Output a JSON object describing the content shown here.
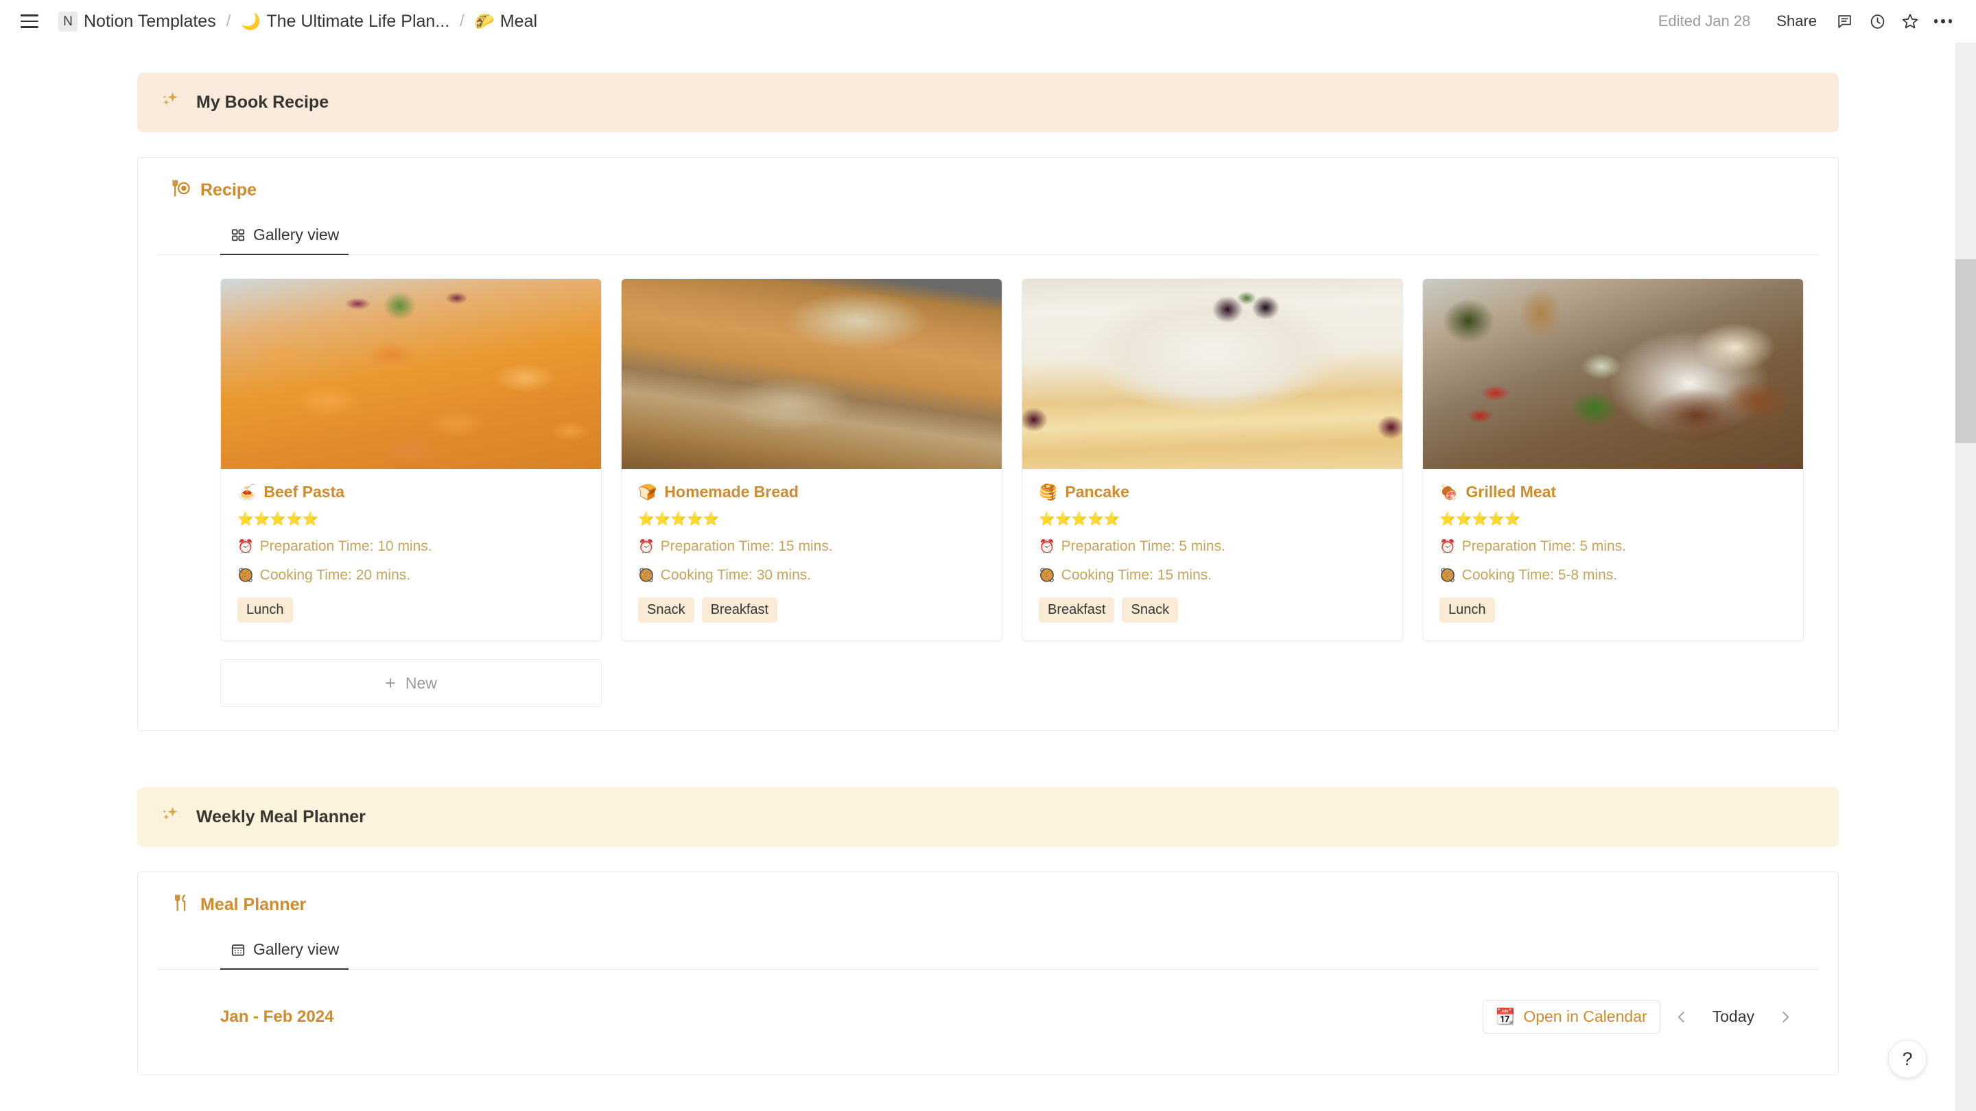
{
  "topbar": {
    "menu_icon": "hamburger-icon",
    "breadcrumbs": [
      {
        "icon": "N",
        "icon_name": "notion-logo-badge",
        "label": "Notion Templates"
      },
      {
        "icon": "🌙",
        "icon_name": "crescent-moon-emoji",
        "label": "The Ultimate Life Plan..."
      },
      {
        "icon": "🌮",
        "icon_name": "taco-emoji",
        "label": "Meal"
      }
    ],
    "separator": "/",
    "edited_label": "Edited Jan 28",
    "share_label": "Share",
    "actions": [
      {
        "name": "comment-icon"
      },
      {
        "name": "history-clock-icon"
      },
      {
        "name": "favorite-star-icon"
      },
      {
        "name": "more-options-icon"
      }
    ]
  },
  "callout_recipe": {
    "icon": "sparkles-icon",
    "text": "My Book Recipe",
    "bg": "#faebdd"
  },
  "recipe_db": {
    "icon": "fork-and-plate-icon",
    "title": "Recipe",
    "view_tab": {
      "icon": "gallery-grid-icon",
      "label": "Gallery view"
    },
    "new_button": {
      "label": "New",
      "icon": "plus-icon"
    },
    "cards": [
      {
        "emoji": "🍝",
        "emoji_name": "spaghetti-emoji",
        "title": "Beef Pasta",
        "stars": "⭐⭐⭐⭐⭐",
        "prep": {
          "emoji": "⏰",
          "text": "Preparation Time: 10 mins."
        },
        "cook": {
          "emoji": "🥘",
          "text": "Cooking Time: 20 mins."
        },
        "tags": [
          "Lunch"
        ],
        "image": "img-pasta"
      },
      {
        "emoji": "🍞",
        "emoji_name": "bread-emoji",
        "title": "Homemade Bread",
        "stars": "⭐⭐⭐⭐⭐",
        "prep": {
          "emoji": "⏰",
          "text": "Preparation Time: 15 mins."
        },
        "cook": {
          "emoji": "🥘",
          "text": "Cooking Time: 30 mins."
        },
        "tags": [
          "Snack",
          "Breakfast"
        ],
        "image": "img-bread"
      },
      {
        "emoji": "🥞",
        "emoji_name": "pancakes-emoji",
        "title": "Pancake",
        "stars": "⭐⭐⭐⭐⭐",
        "prep": {
          "emoji": "⏰",
          "text": "Preparation Time: 5 mins."
        },
        "cook": {
          "emoji": "🥘",
          "text": "Cooking Time: 15 mins."
        },
        "tags": [
          "Breakfast",
          "Snack"
        ],
        "image": "img-pancake"
      },
      {
        "emoji": "🍖",
        "emoji_name": "meat-on-bone-emoji",
        "title": "Grilled Meat",
        "stars": "⭐⭐⭐⭐⭐",
        "prep": {
          "emoji": "⏰",
          "text": "Preparation Time: 5 mins."
        },
        "cook": {
          "emoji": "🥘",
          "text": "Cooking Time: 5-8 mins."
        },
        "tags": [
          "Lunch"
        ],
        "image": "img-meat"
      }
    ]
  },
  "callout_planner": {
    "icon": "sparkles-icon",
    "text": "Weekly Meal Planner",
    "bg": "#fbf3db"
  },
  "planner_db": {
    "icon": "fork-and-knife-icon",
    "title": "Meal Planner",
    "view_tab": {
      "icon": "calendar-icon",
      "label": "Gallery view"
    },
    "date_range": "Jan - Feb 2024",
    "open_calendar": {
      "emoji": "📆",
      "label": "Open in Calendar"
    },
    "prev_label": "previous-period",
    "today_label": "Today",
    "next_label": "next-period"
  },
  "help": {
    "label": "?"
  },
  "colors": {
    "accent_gold": "#cf8b2e",
    "meta_gold": "#c8a45c",
    "tag_bg": "#faebd7",
    "text": "#37352f",
    "muted": "#9b9a97"
  }
}
